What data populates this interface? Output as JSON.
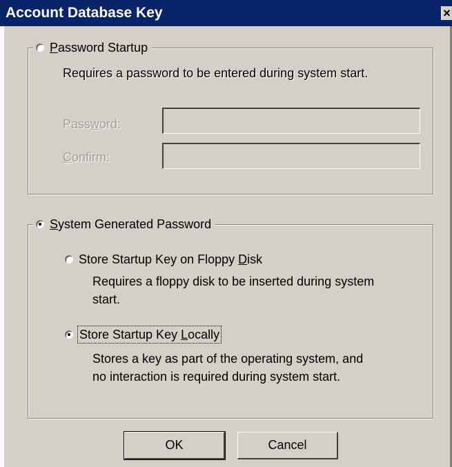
{
  "window": {
    "title": "Account Database Key",
    "close_glyph": "×"
  },
  "password_startup": {
    "label_pre": "",
    "label_u": "P",
    "label_post": "assword Startup",
    "description": "Requires a password to be entered during system start.",
    "password_label_pre": "Pass",
    "password_label_u": "w",
    "password_label_post": "ord:",
    "password_value": "",
    "confirm_label_pre": "",
    "confirm_label_u": "C",
    "confirm_label_post": "onfirm:",
    "confirm_value": "",
    "selected": false,
    "enabled": false
  },
  "system_generated": {
    "label_pre": "",
    "label_u": "S",
    "label_post": "ystem Generated Password",
    "selected": true,
    "floppy": {
      "label_pre": "Store Startup Key on Floppy ",
      "label_u": "D",
      "label_post": "isk",
      "description_line1": "Requires a floppy disk to be inserted during system",
      "description_line2": "start.",
      "selected": false
    },
    "local": {
      "label_pre": "Store Startup Key ",
      "label_u": "L",
      "label_post": "ocally",
      "description_line1": "Stores a key as part of the operating system, and",
      "description_line2": "no interaction is required during system start.",
      "selected": true
    }
  },
  "buttons": {
    "ok": "OK",
    "cancel": "Cancel"
  },
  "colors": {
    "titlebar": "#0a246a",
    "face": "#d4d0c8",
    "disabled_text": "#a09e98"
  }
}
